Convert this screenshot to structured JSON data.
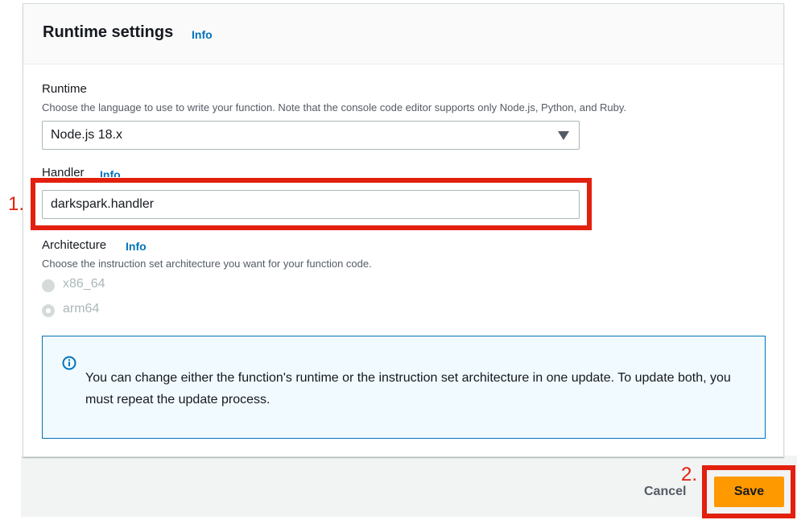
{
  "section": {
    "title": "Runtime settings",
    "info_label": "Info"
  },
  "runtime": {
    "label": "Runtime",
    "description": "Choose the language to use to write your function. Note that the console code editor supports only Node.js, Python, and Ruby.",
    "selected": "Node.js 18.x"
  },
  "handler": {
    "label": "Handler",
    "info_label": "Info",
    "value": "darkspark.handler"
  },
  "architecture": {
    "label": "Architecture",
    "info_label": "Info",
    "description": "Choose the instruction set architecture you want for your function code.",
    "options": [
      {
        "label": "x86_64",
        "selected": false,
        "disabled": true
      },
      {
        "label": "arm64",
        "selected": true,
        "disabled": true
      }
    ]
  },
  "alert": {
    "icon": "info-circle-icon",
    "text": "You can change either the function's runtime or the instruction set architecture in one update. To update both, you must repeat the update process."
  },
  "actions": {
    "cancel_label": "Cancel",
    "save_label": "Save"
  },
  "annotations": {
    "step1": "1.",
    "step2": "2."
  },
  "colors": {
    "primary_button": "#ff9900",
    "link": "#0073bb",
    "annotation": "#e2200d",
    "alert_border": "#0073bb",
    "alert_background": "#f1faff"
  }
}
